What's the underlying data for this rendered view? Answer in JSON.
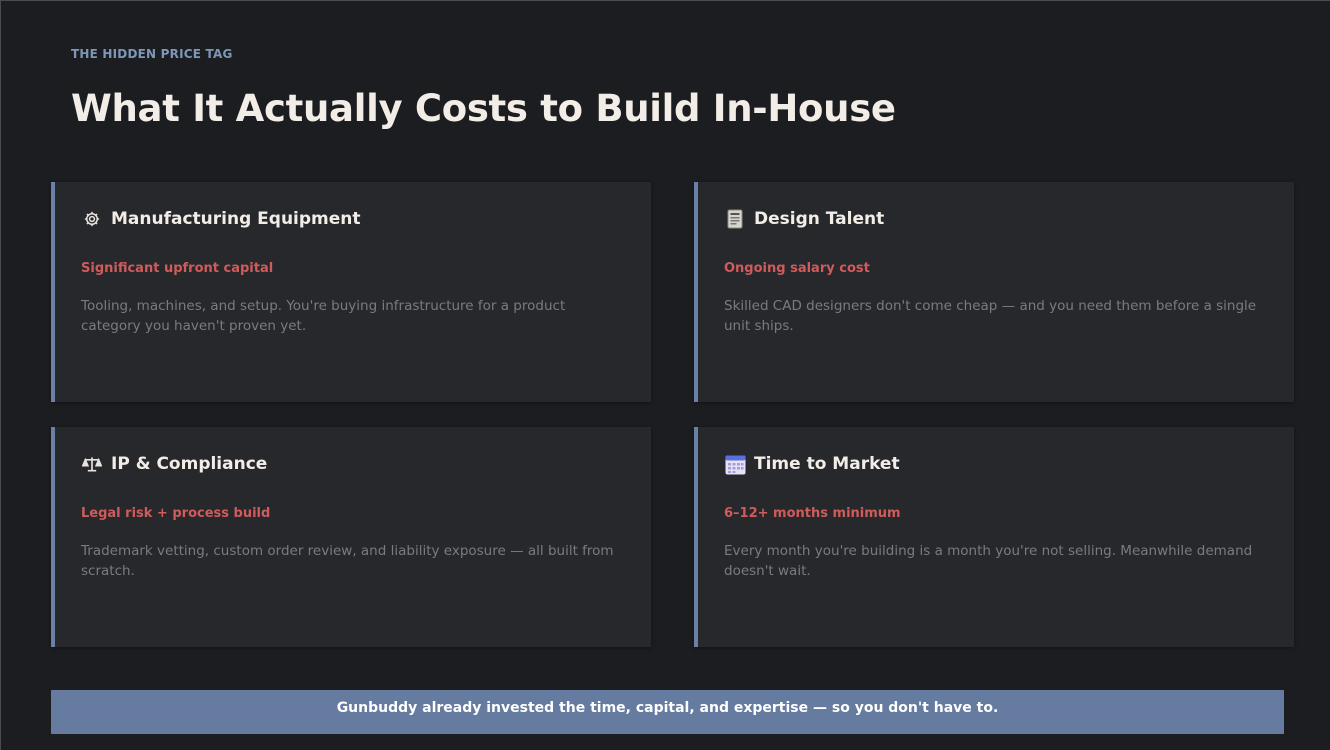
{
  "header": {
    "eyebrow": "THE HIDDEN PRICE TAG",
    "title": "What It Actually Costs to Build In-House"
  },
  "cards": [
    {
      "icon": "gear-icon",
      "title": "Manufacturing Equipment",
      "subtitle": "Significant upfront capital",
      "description": "Tooling, machines, and setup. You're buying infrastructure for a product category you haven't proven yet."
    },
    {
      "icon": "drafting-icon",
      "title": "Design Talent",
      "subtitle": "Ongoing salary cost",
      "description": "Skilled CAD designers don't come cheap — and you need them before a single unit ships."
    },
    {
      "icon": "scales-icon",
      "title": "IP & Compliance",
      "subtitle": "Legal risk + process build",
      "description": "Trademark vetting, custom order review, and liability exposure — all built from scratch."
    },
    {
      "icon": "calendar-icon",
      "title": "Time to Market",
      "subtitle": "6–12+ months minimum",
      "description": "Every month you're building is a month you're not selling. Meanwhile demand doesn't wait."
    }
  ],
  "banner": {
    "text": "Gunbuddy already invested the time, capital, and expertise — so you don't have to."
  },
  "colors": {
    "background": "#1c1d20",
    "card": "#27282c",
    "accent": "#6a80a6",
    "subtitle_red": "#d15b5b",
    "eyebrow": "#7e97b7",
    "banner": "#657b9f"
  }
}
